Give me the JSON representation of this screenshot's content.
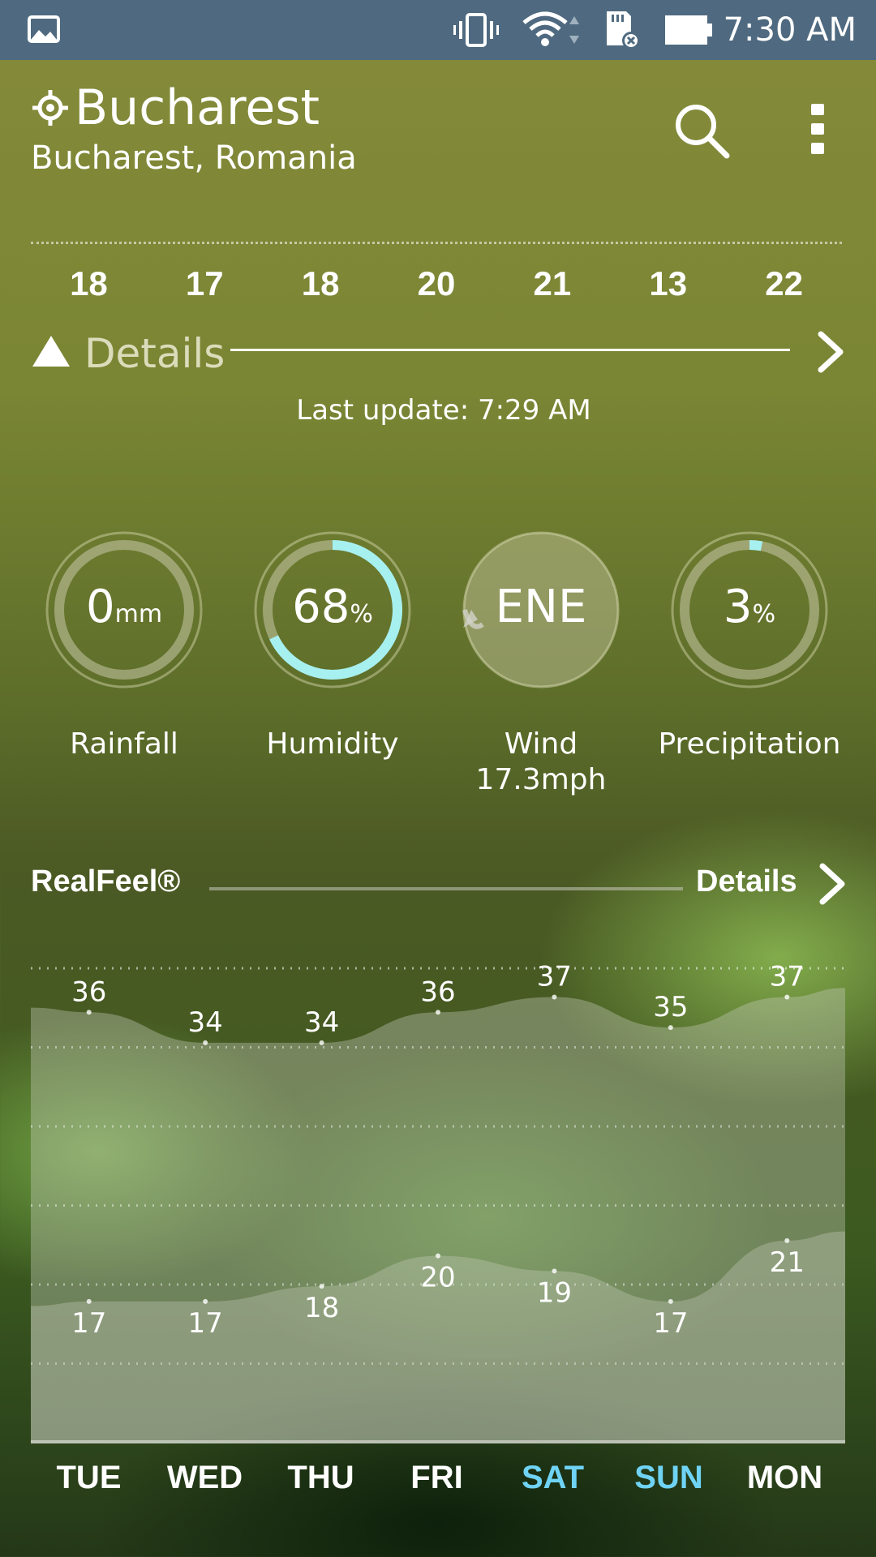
{
  "status_bar": {
    "time": "7:30 AM",
    "icons": [
      "gallery-icon",
      "vibrate-icon",
      "wifi-icon",
      "sd-card-error-icon",
      "battery-icon"
    ]
  },
  "header": {
    "city": "Bucharest",
    "region": "Bucharest, Romania"
  },
  "forecast_temps": [
    "18",
    "17",
    "18",
    "20",
    "21",
    "13",
    "22"
  ],
  "details": {
    "label": "Details",
    "last_update": "Last update: 7:29 AM"
  },
  "gauges": [
    {
      "value": "0",
      "unit": "mm",
      "label": "Rainfall",
      "sub": "",
      "fill_fraction": 0
    },
    {
      "value": "68",
      "unit": "%",
      "label": "Humidity",
      "sub": "",
      "fill_fraction": 0.68
    },
    {
      "value": "ENE",
      "unit": "",
      "label": "Wind",
      "sub": "17.3mph",
      "fill_fraction": 0
    },
    {
      "value": "3",
      "unit": "%",
      "label": "Precipitation",
      "sub": "",
      "fill_fraction": 0.03
    }
  ],
  "realfeel": {
    "title": "RealFeel®",
    "details_label": "Details"
  },
  "chart_data": {
    "type": "area",
    "categories": [
      "TUE",
      "WED",
      "THU",
      "FRI",
      "SAT",
      "SUN",
      "MON"
    ],
    "series": [
      {
        "values": [
          36,
          34,
          34,
          36,
          37,
          35,
          37
        ]
      },
      {
        "values": [
          17,
          17,
          18,
          20,
          19,
          17,
          21
        ]
      }
    ],
    "ylim": [
      13,
      39
    ],
    "grid": true
  },
  "days": [
    "TUE",
    "WED",
    "THU",
    "FRI",
    "SAT",
    "SUN",
    "MON"
  ],
  "colors": {
    "accent": "#a6f0ef",
    "weekend": "#6fd3f5",
    "status_bar": "#4f6a80"
  }
}
